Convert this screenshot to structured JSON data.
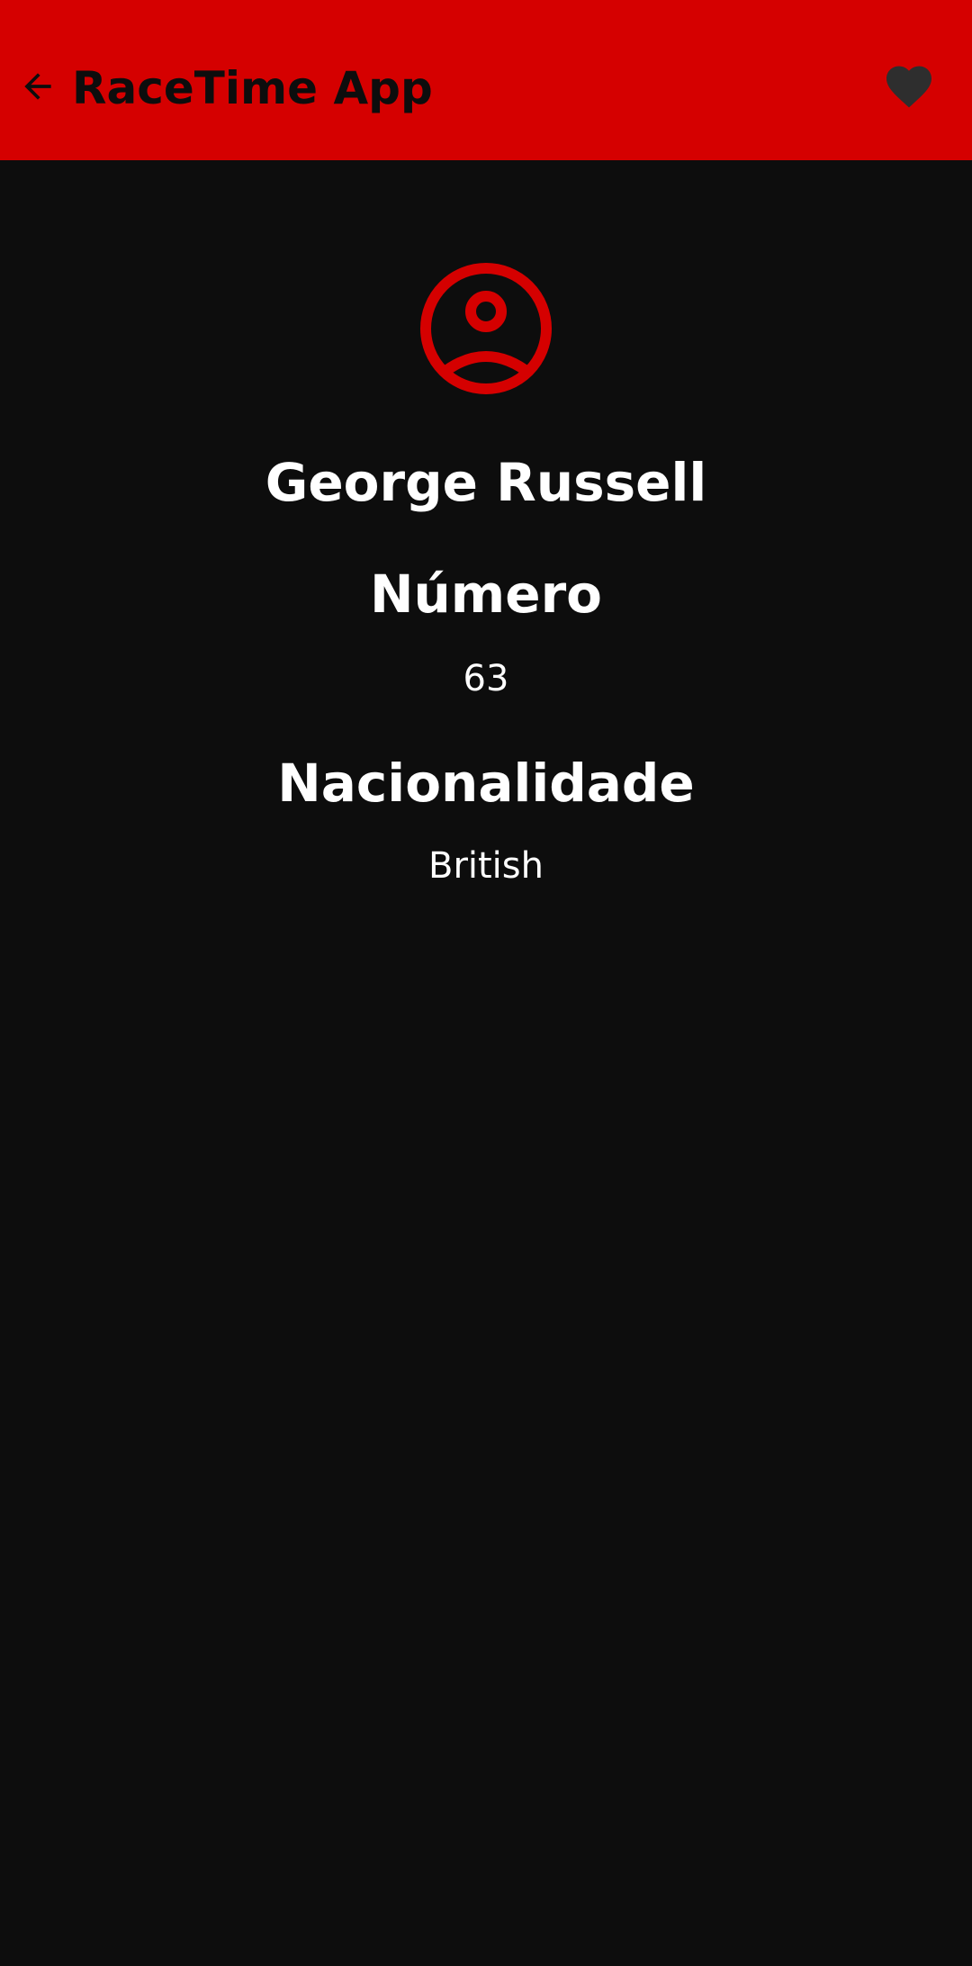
{
  "app_bar": {
    "title": "RaceTime App",
    "background_color": "#d50000",
    "back_icon": "arrow-left-icon",
    "favorite_icon": "heart-icon"
  },
  "driver": {
    "avatar_icon": "account-circle-icon",
    "name": "George Russell",
    "number_label": "Número",
    "number_value": "63",
    "nationality_label": "Nacionalidade",
    "nationality_value": "British"
  },
  "colors": {
    "accent": "#d50000",
    "background": "#0d0d0d",
    "text": "#ffffff",
    "favorite_inactive": "#2e2e2e"
  }
}
